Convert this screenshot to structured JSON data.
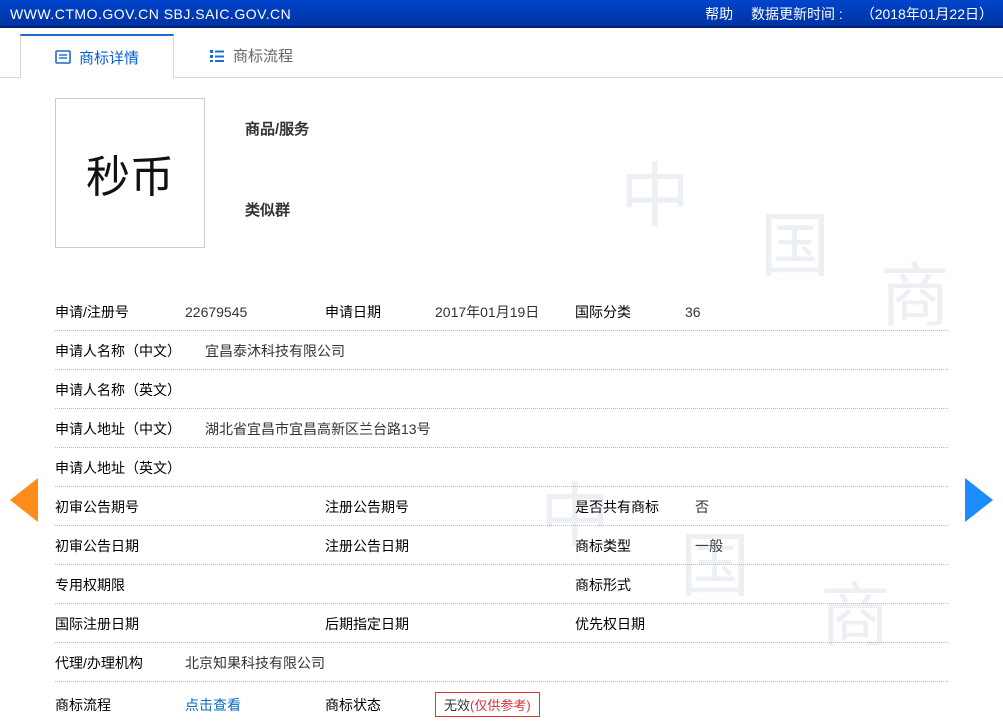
{
  "header": {
    "url_left": "WWW.CTMO.GOV.CN SBJ.SAIC.GOV.CN",
    "help": "帮助",
    "update_label": "数据更新时间 :",
    "update_time": "（2018年01月22日）"
  },
  "tabs": {
    "detail": "商标详情",
    "process": "商标流程"
  },
  "logo_text": "秒币",
  "section": {
    "goods_services": "商品/服务",
    "similar_group": "类似群"
  },
  "fields": {
    "reg_no_label": "申请/注册号",
    "reg_no": "22679545",
    "app_date_label": "申请日期",
    "app_date": "2017年01月19日",
    "intl_class_label": "国际分类",
    "intl_class": "36",
    "applicant_cn_label": "申请人名称（中文）",
    "applicant_cn": "宜昌泰沐科技有限公司",
    "applicant_en_label": "申请人名称（英文）",
    "applicant_en": "",
    "addr_cn_label": "申请人地址（中文）",
    "addr_cn": "湖北省宜昌市宜昌高新区兰台路13号",
    "addr_en_label": "申请人地址（英文）",
    "addr_en": "",
    "prelim_no_label": "初审公告期号",
    "prelim_no": "",
    "reg_ann_no_label": "注册公告期号",
    "reg_ann_no": "",
    "is_common_label": "是否共有商标",
    "is_common": "否",
    "prelim_date_label": "初审公告日期",
    "prelim_date": "",
    "reg_ann_date_label": "注册公告日期",
    "reg_ann_date": "",
    "tm_type_label": "商标类型",
    "tm_type": "一般",
    "exclusive_label": "专用权期限",
    "exclusive": "",
    "tm_form_label": "商标形式",
    "tm_form": "",
    "intl_reg_date_label": "国际注册日期",
    "intl_reg_date": "",
    "late_desig_label": "后期指定日期",
    "late_desig": "",
    "priority_label": "优先权日期",
    "priority": "",
    "agent_label": "代理/办理机构",
    "agent": "北京知果科技有限公司",
    "process_label": "商标流程",
    "process_link": "点击查看",
    "status_label": "商标状态",
    "status_value": "无效",
    "status_note": "(仅供参考)"
  }
}
